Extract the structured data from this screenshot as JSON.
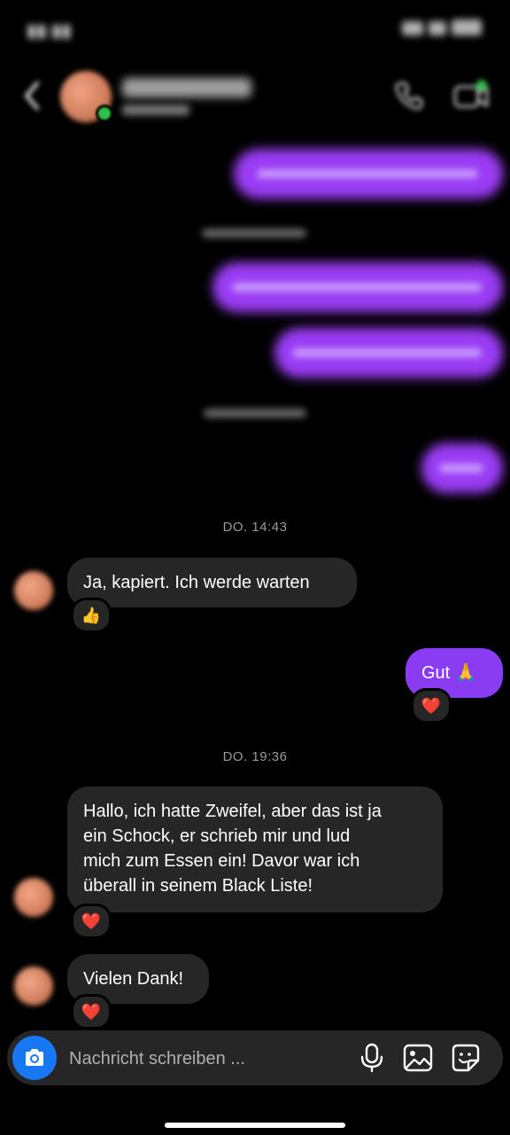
{
  "composer": {
    "placeholder": "Nachricht schreiben ..."
  },
  "conversation": {
    "timestamps": [
      "DO. 14:43",
      "DO. 19:36"
    ],
    "messages": [
      {
        "direction": "incoming",
        "text": "Ja, kapiert. Ich werde warten",
        "reaction": "👍"
      },
      {
        "direction": "outgoing",
        "text": "Gut 🙏",
        "reaction": "❤️"
      },
      {
        "direction": "incoming",
        "lines": [
          "Hallo, ich hatte Zweifel, aber das ist ja",
          "ein Schock, er schrieb mir und lud",
          "mich zum Essen ein! Davor war ich",
          "überall in seinem Black Liste!"
        ],
        "reaction": "❤️"
      },
      {
        "direction": "incoming",
        "text": "Vielen Dank!",
        "reaction": "❤️"
      }
    ]
  },
  "colors": {
    "outgoing_bubble": "#8a3cf3",
    "incoming_bubble": "#262626",
    "camera_button": "#1877f2",
    "online_status": "#2fbf4a",
    "background": "#000000"
  },
  "icons": [
    "back-icon",
    "phone-icon",
    "video-call-icon",
    "camera-icon",
    "microphone-icon",
    "image-icon",
    "sticker-icon"
  ]
}
